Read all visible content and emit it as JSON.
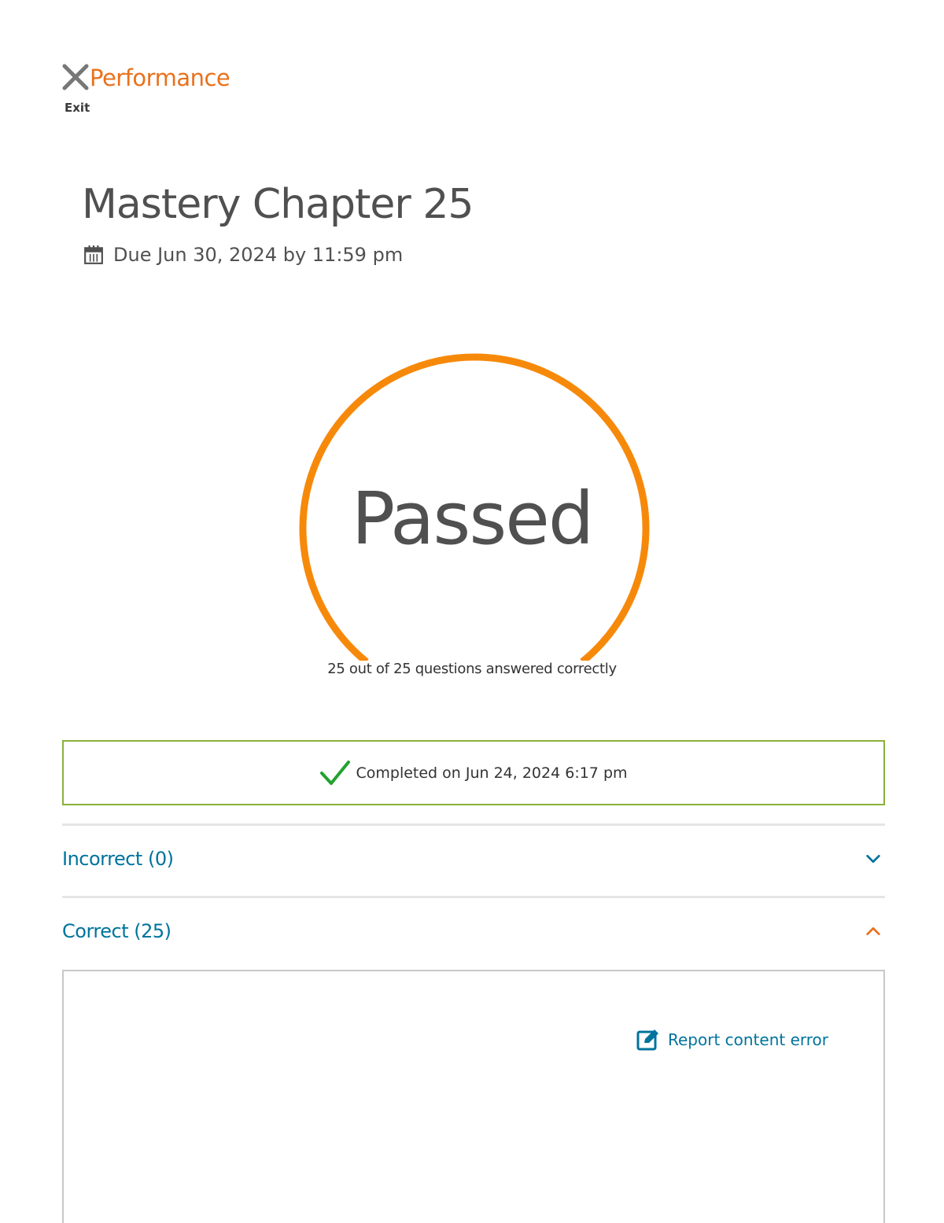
{
  "header": {
    "title": "Performance",
    "exit_label": "Exit"
  },
  "assignment": {
    "title": "Mastery Chapter 25",
    "due": "Due Jun 30, 2024 by 11:59 pm"
  },
  "result": {
    "status": "Passed",
    "correct": 25,
    "total": 25,
    "summary": "25 out of 25 questions answered correctly"
  },
  "completion": {
    "text": "Completed on Jun 24, 2024 6:17 pm"
  },
  "sections": [
    {
      "label": "Incorrect (0)",
      "expanded": false
    },
    {
      "label": "Correct (25)",
      "expanded": true
    }
  ],
  "panel": {
    "report_label": "Report content error"
  },
  "colors": {
    "accent_orange": "#f7890a",
    "title_orange": "#e9711c",
    "link_blue": "#00739d",
    "success_green": "#22a22f",
    "border_green": "#8bb03a",
    "text_gray": "#505050"
  },
  "icons": {
    "exit": "close-icon",
    "due": "calendar-icon",
    "completed": "checkmark-icon",
    "collapsed": "chevron-down-icon",
    "expanded": "chevron-up-icon",
    "report": "edit-icon"
  }
}
